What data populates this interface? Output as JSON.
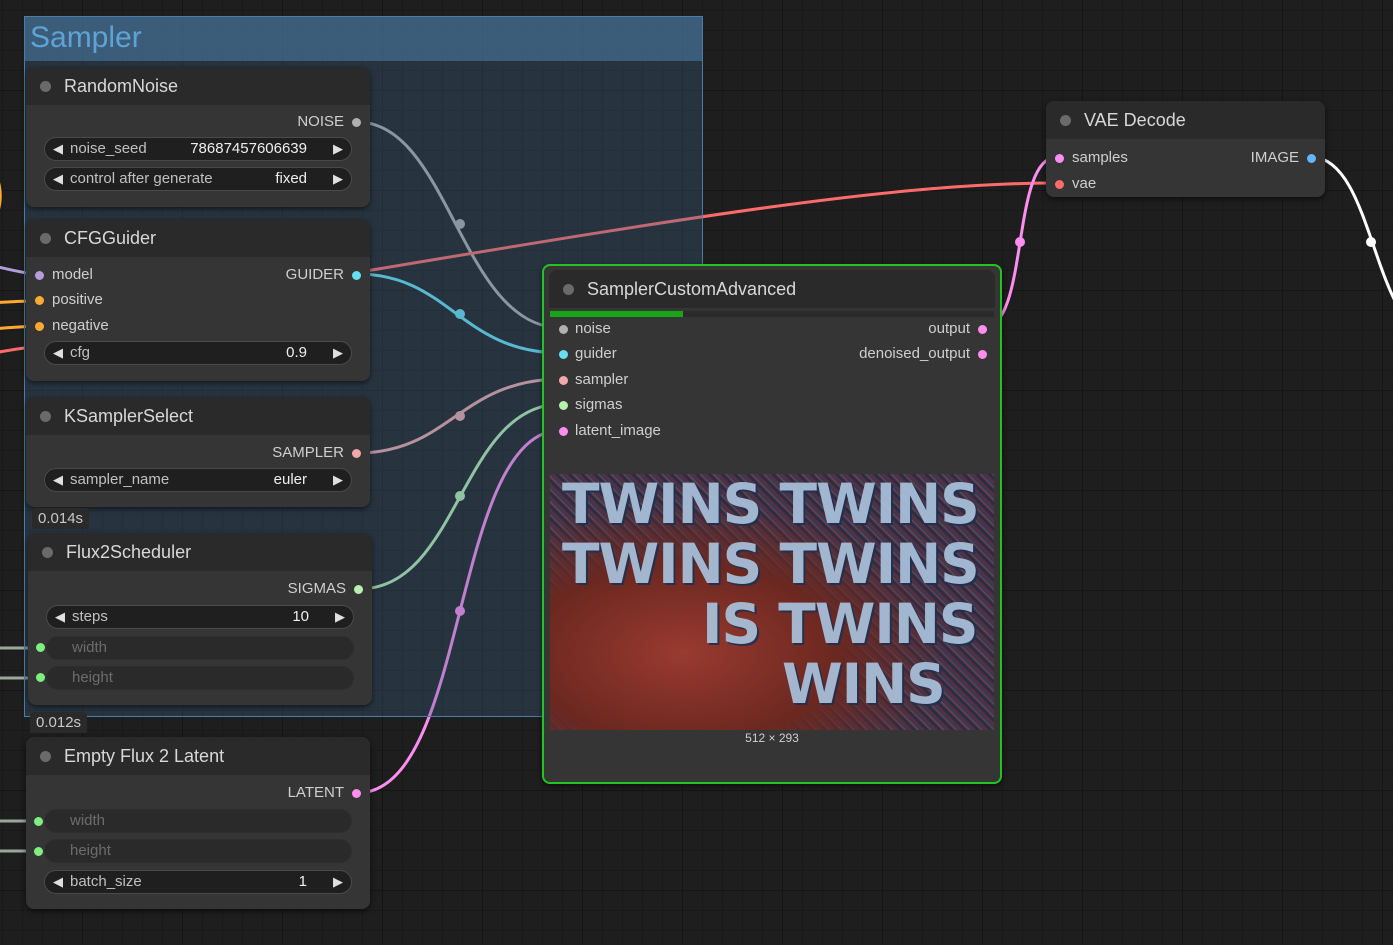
{
  "group": {
    "title": "Sampler"
  },
  "random_noise": {
    "title": "RandomNoise",
    "output": "NOISE",
    "widgets": [
      {
        "label": "noise_seed",
        "value": "78687457606639"
      },
      {
        "label": "control after generate",
        "value": "fixed"
      }
    ]
  },
  "cfg_guider": {
    "title": "CFGGuider",
    "inputs": [
      "model",
      "positive",
      "negative"
    ],
    "output": "GUIDER",
    "cfg": {
      "label": "cfg",
      "value": "0.9"
    }
  },
  "ksampler_select": {
    "title": "KSamplerSelect",
    "output": "SAMPLER",
    "sampler_name": {
      "label": "sampler_name",
      "value": "euler"
    },
    "timing": "0.014s"
  },
  "flux2_scheduler": {
    "title": "Flux2Scheduler",
    "output": "SIGMAS",
    "steps": {
      "label": "steps",
      "value": "10"
    },
    "width": "width",
    "height": "height",
    "timing": "0.012s"
  },
  "empty_latent": {
    "title": "Empty Flux 2 Latent",
    "output": "LATENT",
    "width": "width",
    "height": "height",
    "batch_size": {
      "label": "batch_size",
      "value": "1"
    }
  },
  "sampler_custom": {
    "title": "SamplerCustomAdvanced",
    "inputs": [
      "noise",
      "guider",
      "sampler",
      "sigmas",
      "latent_image"
    ],
    "outputs": [
      "output",
      "denoised_output"
    ],
    "preview_size": "512 × 293",
    "preview_text": [
      "TWINS TWINS",
      "TWINS TWINS",
      "IS TWINS",
      "WINS"
    ],
    "progress": 0.3
  },
  "vae_decode": {
    "title": "VAE Decode",
    "inputs": [
      "samples",
      "vae"
    ],
    "output": "IMAGE"
  },
  "colors": {
    "noise": "#b0b0b0",
    "guider": "#66e0f0",
    "sampler": "#f0a8a8",
    "sigmas": "#b8f0b0",
    "latent": "#ff8ef0",
    "vae": "#ff6b6b",
    "image": "#64b5f6",
    "model": "#b39ddb",
    "conditioning": "#ffa931",
    "int": "#7ef07e"
  }
}
